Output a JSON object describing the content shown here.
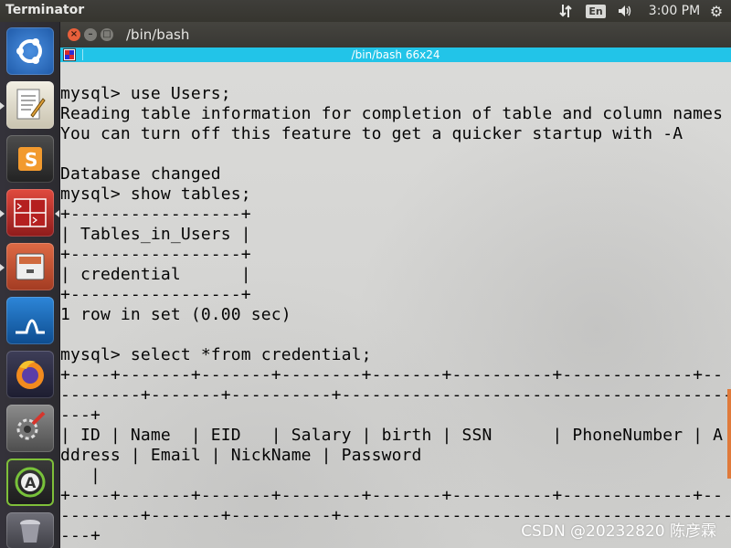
{
  "top_panel": {
    "app_title": "Terminator",
    "keyboard_layout": "En",
    "clock": "3:00 PM",
    "icons": [
      "network-icon",
      "keyboard-icon",
      "sound-icon",
      "settings-gear-icon"
    ]
  },
  "launcher": {
    "items": [
      {
        "name": "ubuntu-dash-icon",
        "color": "#3b7fd6"
      },
      {
        "name": "text-editor-icon",
        "color": "#d9d4c4"
      },
      {
        "name": "sublime-text-icon",
        "color": "#f09d2e"
      },
      {
        "name": "terminator-icon",
        "color": "#c0292b"
      },
      {
        "name": "file-manager-icon",
        "color": "#c8563a"
      },
      {
        "name": "wireshark-icon",
        "color": "#1c6fbf"
      },
      {
        "name": "firefox-icon",
        "color": "#e8712a"
      },
      {
        "name": "system-tools-icon",
        "color": "#9a9a9a"
      },
      {
        "name": "software-updater-icon",
        "color": "#3d8a3a"
      },
      {
        "name": "trash-icon",
        "color": "#6a6a70"
      }
    ]
  },
  "window": {
    "title": "/bin/bash",
    "tab_title": "/bin/bash 66x24"
  },
  "terminal": {
    "lines": [
      "",
      "mysql> use Users;",
      "Reading table information for completion of table and column names",
      "You can turn off this feature to get a quicker startup with -A",
      "",
      "Database changed",
      "mysql> show tables;",
      "+-----------------+",
      "| Tables_in_Users |",
      "+-----------------+",
      "| credential      |",
      "+-----------------+",
      "1 row in set (0.00 sec)",
      "",
      "mysql> select *from credential;",
      "+----+-------+-------+--------+-------+----------+-------------+--",
      "--------+-------+----------+------------------------------------------",
      "---+",
      "| ID | Name  | EID   | Salary | birth | SSN      | PhoneNumber | A",
      "ddress | Email | NickName | Password",
      "   |",
      "+----+-------+-------+--------+-------+----------+-------------+--",
      "--------+-------+----------+------------------------------------------",
      "---+"
    ]
  },
  "watermark": "CSDN @20232820 陈彦霖"
}
